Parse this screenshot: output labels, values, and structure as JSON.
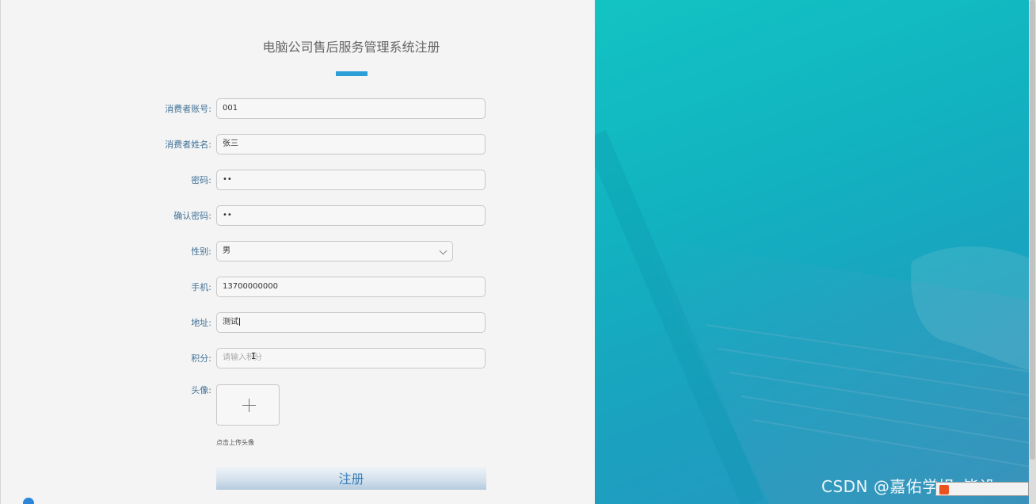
{
  "form": {
    "title": "电脑公司售后服务管理系统注册",
    "fields": [
      {
        "label": "消费者账号:",
        "value": "001"
      },
      {
        "label": "消费者姓名:",
        "value": "张三"
      },
      {
        "label": "密码:",
        "value": "••"
      },
      {
        "label": "确认密码:",
        "value": "••"
      },
      {
        "label": "性别:",
        "value": "男"
      },
      {
        "label": "手机:",
        "value": "13700000000"
      },
      {
        "label": "地址:",
        "value": "测试"
      },
      {
        "label": "积分:",
        "placeholder": "请输入积分"
      }
    ],
    "avatar": {
      "label": "头像:",
      "hint": "点击上传头像"
    },
    "submit_label": "注册"
  },
  "watermark": {
    "text": "CSDN @嘉佑学姐_毕设"
  },
  "colors": {
    "accent": "#2c9fd8",
    "label": "#417196",
    "right_bg": "#13c3c3"
  },
  "icons": [
    "plus-icon",
    "chevron-down-icon",
    "text-cursor-icon",
    "ime-logo-icon"
  ]
}
